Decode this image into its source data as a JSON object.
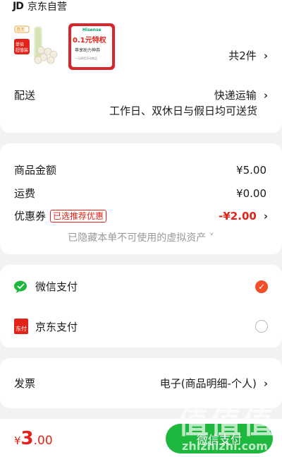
{
  "shop": {
    "logo_text": "JD",
    "name": "京东自营"
  },
  "products": {
    "item1": {
      "brand": "惠而",
      "tags": [
        "单倍",
        "超值装"
      ]
    },
    "item2": {
      "brand": "Hisense",
      "headline": "0.1元特权",
      "sub": "尊享助力神券",
      "fine": "一元体验活动商品"
    },
    "count_label": "共2件"
  },
  "delivery": {
    "label": "配送",
    "method": "快递运输",
    "note": "工作日、双休日与假日均可送货"
  },
  "summary": {
    "goods_label": "商品金额",
    "goods_value": "¥5.00",
    "shipping_label": "运费",
    "shipping_value": "¥0.00",
    "coupon_label": "优惠券",
    "coupon_badge": "已选推荐优惠",
    "coupon_value": "-¥2.00",
    "hidden_note": "已隐藏本单不可使用的虚拟资产 ˅"
  },
  "payment": {
    "wechat_label": "微信支付",
    "jd_label": "京东支付",
    "jd_icon_text": "东付"
  },
  "invoice": {
    "label": "发票",
    "value": "电子(商品明细-个人)"
  },
  "footer": {
    "currency": "¥",
    "amount": "3",
    "decimals": ".00",
    "pay_button": "微信支付"
  },
  "watermark": {
    "big": "值值值",
    "small": "zhizhizhi.com"
  },
  "colors": {
    "accent": "#e2231a",
    "wechat_green": "#1fb83e",
    "check_orange": "#f24e2b"
  }
}
